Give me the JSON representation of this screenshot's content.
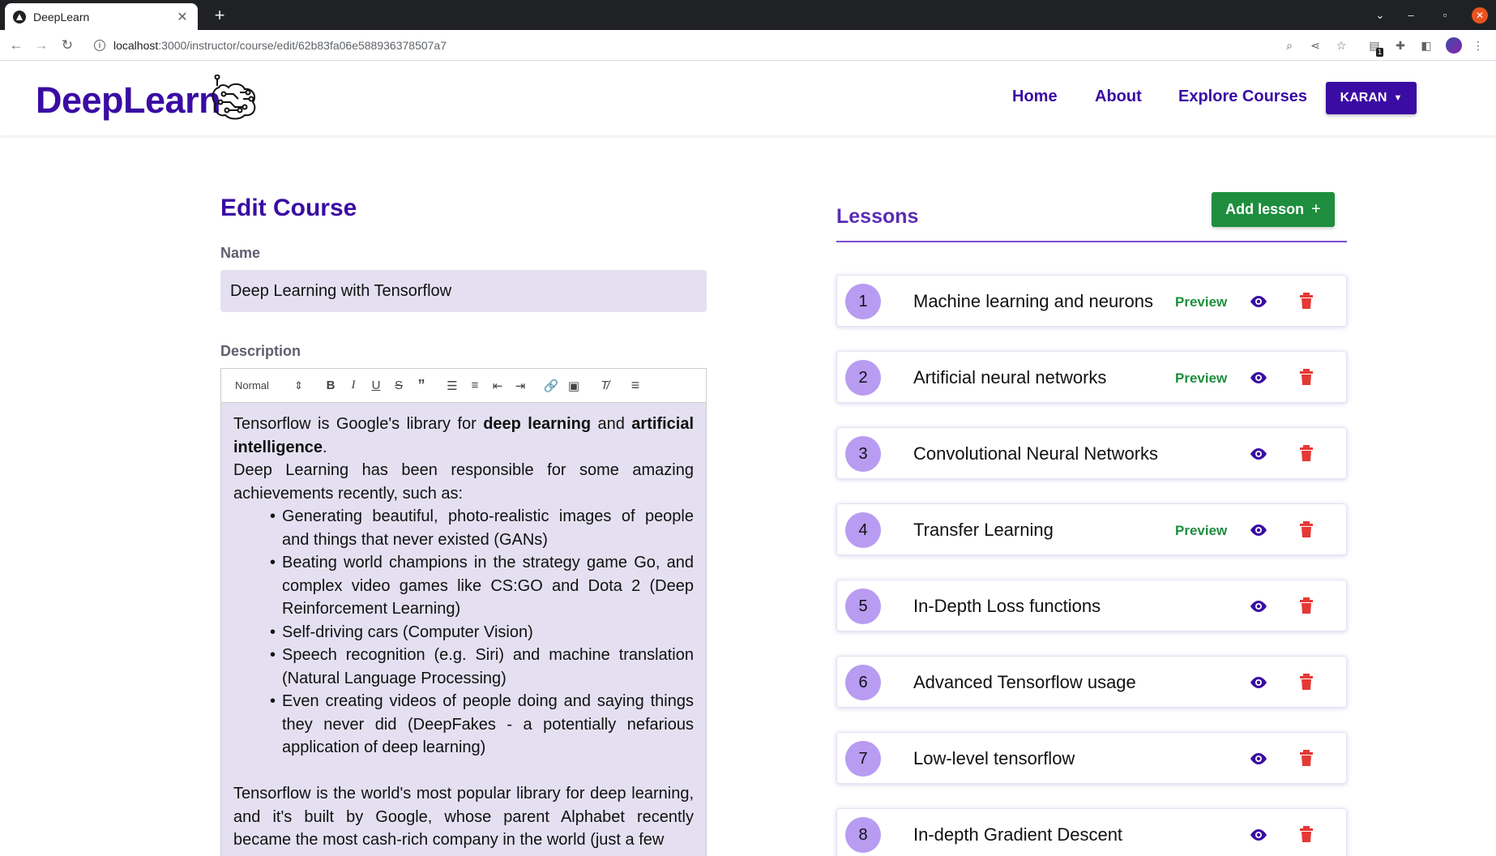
{
  "browser": {
    "tab_title": "DeepLearn",
    "url_host": "localhost",
    "url_path": ":3000/instructor/course/edit/62b83fa06e588936378507a7",
    "extension_badge": "1"
  },
  "header": {
    "logo": "DeepLearn",
    "nav": {
      "home": "Home",
      "about": "About",
      "explore": "Explore Courses"
    },
    "user_button": "KARAN"
  },
  "edit_course": {
    "title": "Edit Course",
    "name_label": "Name",
    "name_value": "Deep Learning with Tensorflow",
    "description_label": "Description",
    "toolbar": {
      "format_select": "Normal"
    },
    "description": {
      "p1_a": "Tensorflow is Google's library for ",
      "p1_b": "deep learning",
      "p1_c": " and ",
      "p1_d": "artificial intelligence",
      "p1_e": ".",
      "p2": "Deep Learning has been responsible for some amazing achievements recently, such as:",
      "bullets": [
        "Generating beautiful, photo-realistic images of people and things that never existed (GANs)",
        "Beating world champions in the strategy game Go, and complex video games like CS:GO and Dota 2 (Deep Reinforcement Learning)",
        "Self-driving cars (Computer Vision)",
        "Speech recognition (e.g. Siri) and machine translation (Natural Language Processing)",
        "Even creating videos of people doing and saying things they never did (DeepFakes - a potentially nefarious application of deep learning)"
      ],
      "p3": "Tensorflow is the world's most popular library for deep learning, and it's built by Google, whose parent Alphabet recently became the most cash-rich company in the world (just a few"
    }
  },
  "lessons": {
    "title": "Lessons",
    "add_button": "Add lesson",
    "preview_label": "Preview",
    "items": [
      {
        "number": "1",
        "title": "Machine learning and neurons",
        "preview": true
      },
      {
        "number": "2",
        "title": "Artificial neural networks",
        "preview": true
      },
      {
        "number": "3",
        "title": "Convolutional Neural Networks",
        "preview": false
      },
      {
        "number": "4",
        "title": "Transfer Learning",
        "preview": true
      },
      {
        "number": "5",
        "title": "In-Depth Loss functions",
        "preview": false
      },
      {
        "number": "6",
        "title": "Advanced Tensorflow usage",
        "preview": false
      },
      {
        "number": "7",
        "title": "Low-level tensorflow",
        "preview": false
      },
      {
        "number": "8",
        "title": "In-depth Gradient Descent",
        "preview": false
      }
    ]
  },
  "colors": {
    "brand": "#3a0ca3",
    "lessons_title": "#5a2db3",
    "success": "#1e8e3e",
    "danger": "#e53935",
    "lesson_badge": "#b79cf2",
    "input_bg": "#e4e0f1"
  },
  "icons": {
    "eye": "eye-icon",
    "delete": "trash-icon",
    "add": "plus-icon",
    "caret": "caret-down-icon"
  }
}
